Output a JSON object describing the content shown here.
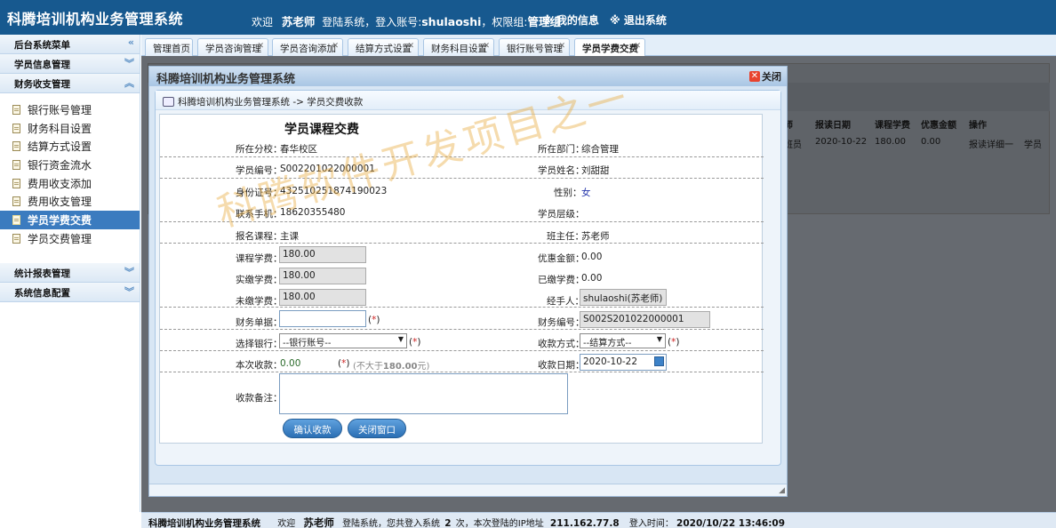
{
  "header": {
    "app_title": "科腾培训机构业务管理系统",
    "welcome": "欢迎",
    "user_name": "苏老师",
    "login_text": "登陆系统，登入账号:",
    "account": "shulaoshi",
    "perm_text": "，权限组:",
    "perm_group": "管理组",
    "my_info": "※ 我的信息",
    "logout": "※ 退出系统"
  },
  "sidebar": {
    "title": "后台系统菜单",
    "sections": [
      {
        "label": "学员信息管理",
        "chevron": "expand"
      },
      {
        "label": "财务收支管理",
        "chevron": "collapse"
      },
      {
        "label": "统计报表管理",
        "chevron": "expand"
      },
      {
        "label": "系统信息配置",
        "chevron": "expand"
      }
    ],
    "items": [
      {
        "label": "银行账号管理"
      },
      {
        "label": "财务科目设置"
      },
      {
        "label": "结算方式设置"
      },
      {
        "label": "银行资金流水"
      },
      {
        "label": "费用收支添加"
      },
      {
        "label": "费用收支管理"
      },
      {
        "label": "学员学费交费"
      },
      {
        "label": "学员交费管理"
      }
    ],
    "active_index": 6
  },
  "tabs": [
    {
      "label": "管理首页",
      "closable": false
    },
    {
      "label": "学员咨询管理",
      "closable": true
    },
    {
      "label": "学员咨询添加",
      "closable": true
    },
    {
      "label": "结算方式设置",
      "closable": true
    },
    {
      "label": "财务科目设置",
      "closable": true
    },
    {
      "label": "银行账号管理",
      "closable": true
    },
    {
      "label": "学员学费交费",
      "closable": true
    }
  ],
  "background_table": {
    "headers": [
      "师",
      "报读日期",
      "课程学费",
      "优惠金额",
      "操作"
    ],
    "row": [
      "班员",
      "2020-10-22",
      "180.00",
      "0.00",
      "报读详细一",
      "学员"
    ]
  },
  "modal": {
    "title": "科腾培训机构业务管理系统",
    "close_label": "关闭",
    "breadcrumb": "科腾培训机构业务管理系统 -> 学员交费收款",
    "form_title": "学员课程交费",
    "fields": {
      "campus_label": "所在分校：",
      "campus_value": "春华校区",
      "dept_label": "所在部门：",
      "dept_value": "综合管理",
      "student_no_label": "学员编号：",
      "student_no_value": "S002201022000001",
      "student_name_label": "学员姓名：",
      "student_name_value": "刘甜甜",
      "id_label": "身份证号：",
      "id_value": "432510251874190023",
      "gender_label": "性别：",
      "gender_value": "女",
      "phone_label": "联系手机：",
      "phone_value": "18620355480",
      "level_label": "学员层级：",
      "level_value": "",
      "course_label": "报名课程：",
      "course_value": "主课",
      "teacher_label": "班主任：",
      "teacher_value": "苏老师",
      "tuition_label": "课程学费：",
      "tuition_value": "180.00",
      "discount_label": "优惠金额：",
      "discount_value": "0.00",
      "paid_should_label": "实缴学费：",
      "paid_should_value": "180.00",
      "already_paid_label": "已缴学费：",
      "already_paid_value": "0.00",
      "unpaid_label": "未缴学费：",
      "unpaid_value": "180.00",
      "handler_label": "经手人：",
      "handler_value": "shulaoshi(苏老师)",
      "receipt_label": "财务单据：",
      "receipt_value": "",
      "finance_no_label": "财务编号：",
      "finance_no_value": "S002S201022000001",
      "bank_label": "选择银行：",
      "bank_value": "--银行账号--",
      "method_label": "收款方式：",
      "method_value": "--结算方式--",
      "amount_label": "本次收款：",
      "amount_value": "0.00",
      "amount_note_prefix": "(不大于",
      "amount_note_value": "180.00",
      "amount_note_suffix": "元)",
      "date_label": "收款日期：",
      "date_value": "2020-10-22",
      "remark_label": "收款备注：",
      "required": "*"
    },
    "buttons": {
      "confirm": "确认收款",
      "close": "关闭窗口"
    }
  },
  "watermark": "科腾软件开发项目之一",
  "footer": {
    "app_title": "科腾培训机构业务管理系统",
    "welcome": "欢迎",
    "user_name": "苏老师",
    "login_prefix": "登陆系统，您共登入系统",
    "login_count": "2",
    "login_mid": "次，本次登陆的IP地址",
    "ip": "211.162.77.8",
    "time_label": "登入时间：",
    "time": "2020/10/22 13:46:09"
  },
  "colors": {
    "header_bg": "#17598f",
    "active_menu": "#3b7bbf",
    "required": "#cc2222",
    "button": "#2b6fb4"
  }
}
